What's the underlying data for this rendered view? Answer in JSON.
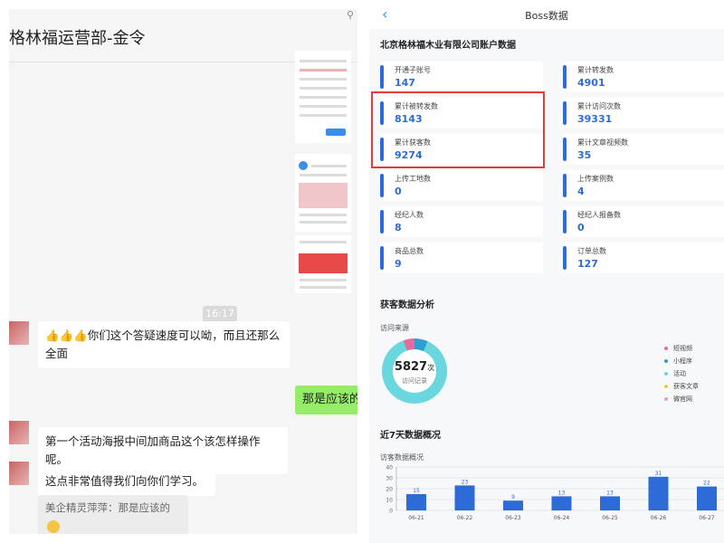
{
  "chat": {
    "title": "格林福运营部-金令",
    "timestamp": "16:17",
    "messages": [
      {
        "emoji": "👍👍👍",
        "text": "你们这个答疑速度可以呦，而且还那么全面"
      },
      {
        "text": "那是应该的"
      },
      {
        "text": "第一个活动海报中间加商品这个该怎样操作呢。"
      },
      {
        "text": "这点非常值得我们向你们学习。"
      }
    ],
    "quote": "美企精灵萍萍：那是应该的"
  },
  "dash": {
    "title": "Boss数据",
    "company": "北京格林福木业有限公司账户数据",
    "stats": [
      {
        "label": "开通子账号",
        "value": "147"
      },
      {
        "label": "累计转发数",
        "value": "4901"
      },
      {
        "label": "累计被转发数",
        "value": "8143"
      },
      {
        "label": "累计访问次数",
        "value": "39331"
      },
      {
        "label": "累计获客数",
        "value": "9274"
      },
      {
        "label": "累计文章视频数",
        "value": "35"
      },
      {
        "label": "上传工地数",
        "value": "0"
      },
      {
        "label": "上传案例数",
        "value": "4"
      },
      {
        "label": "经纪人数",
        "value": "8"
      },
      {
        "label": "经纪人报备数",
        "value": "0"
      },
      {
        "label": "商品总数",
        "value": "9"
      },
      {
        "label": "订单总数",
        "value": "127"
      }
    ],
    "acquisition_title": "获客数据分析",
    "source_title": "访问来源",
    "donut": {
      "value": "5827",
      "unit": "次",
      "label": "访问记录"
    },
    "legend": [
      {
        "label": "短视频",
        "color": "#e86a9a"
      },
      {
        "label": "小程序",
        "color": "#2f9fcf"
      },
      {
        "label": "活动",
        "color": "#6ad7df"
      },
      {
        "label": "获客文章",
        "color": "#e6d23a"
      },
      {
        "label": "微官网",
        "color": "#f0a0b0"
      }
    ],
    "weekly_title": "近7天数据概况",
    "visitor_title": "访客数据概况"
  },
  "chart_data": {
    "type": "bar",
    "categories": [
      "06-21",
      "06-22",
      "06-23",
      "06-24",
      "06-25",
      "06-26",
      "06-27"
    ],
    "values": [
      15,
      23,
      9,
      13,
      13,
      31,
      22
    ],
    "ylim": [
      0,
      40
    ],
    "yticks": [
      0,
      10,
      20,
      30,
      40
    ],
    "color": "#2d6bd8",
    "grid": true
  }
}
